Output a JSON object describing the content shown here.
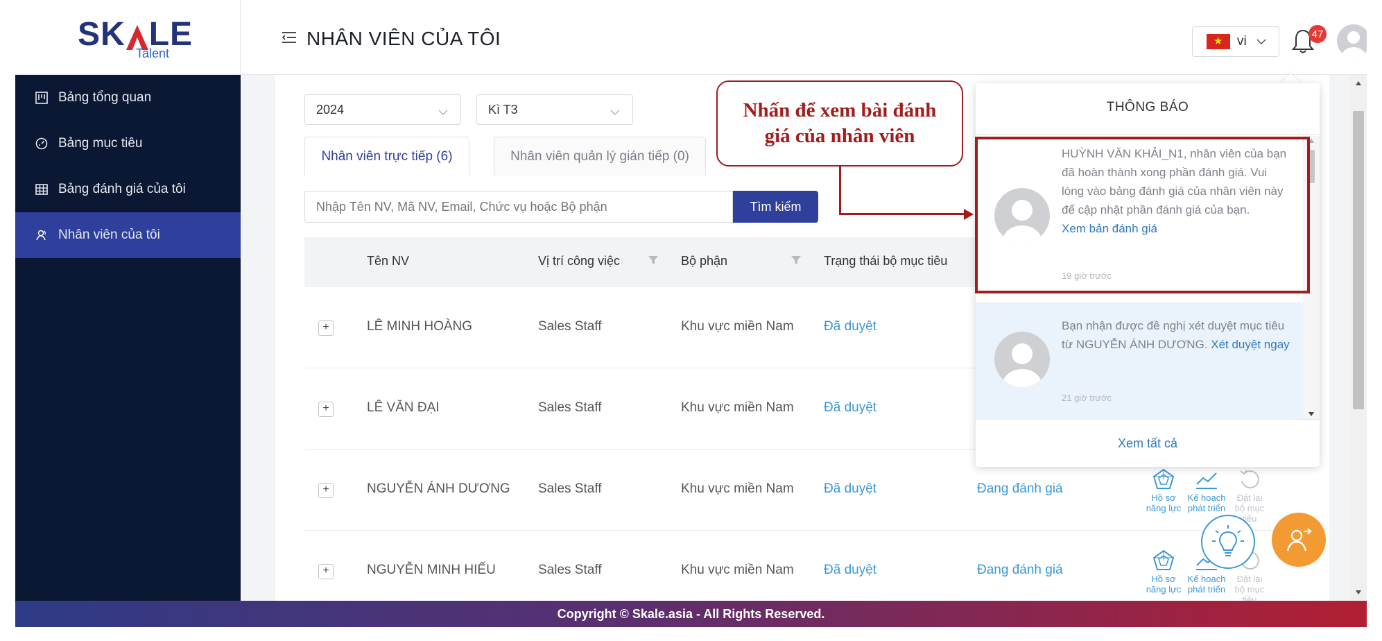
{
  "brand": {
    "logo_text_left": "SK",
    "logo_text_right": "LE",
    "logo_sub": "Talent"
  },
  "sidebar": {
    "items": [
      {
        "label": "Bảng tổng quan",
        "icon": "dashboard-icon"
      },
      {
        "label": "Bảng mục tiêu",
        "icon": "gauge-icon"
      },
      {
        "label": "Bảng đánh giá của tôi",
        "icon": "table-icon"
      },
      {
        "label": "Nhân viên của tôi",
        "icon": "people-icon",
        "active": true
      }
    ]
  },
  "header": {
    "title": "NHÂN VIÊN CỦA TÔI",
    "language": "vi",
    "notification_count": "47"
  },
  "filters": {
    "year": "2024",
    "period": "Kì T3"
  },
  "tabs": [
    {
      "label": "Nhân viên trực tiếp (6)",
      "active": true
    },
    {
      "label": "Nhân viên quản lý gián tiếp (0)",
      "active": false
    }
  ],
  "search": {
    "placeholder": "Nhập Tên NV, Mã NV, Email, Chức vụ hoặc Bộ phận",
    "button": "Tìm kiếm"
  },
  "table": {
    "columns": [
      "Tên NV",
      "Vị trí công việc",
      "Bộ phận",
      "Trạng thái bộ mục tiêu"
    ],
    "rows": [
      {
        "name": "LÊ MINH HOÀNG",
        "position": "Sales Staff",
        "department": "Khu vực miền Nam",
        "goal_status": "Đã duyệt",
        "review_status": ""
      },
      {
        "name": "LÊ VĂN ĐẠI",
        "position": "Sales Staff",
        "department": "Khu vực miền Nam",
        "goal_status": "Đã duyệt",
        "review_status": ""
      },
      {
        "name": "NGUYỄN ÁNH DƯƠNG",
        "position": "Sales Staff",
        "department": "Khu vực miền Nam",
        "goal_status": "Đã duyệt",
        "review_status": "Đang đánh giá"
      },
      {
        "name": "NGUYỄN MINH HIẾU",
        "position": "Sales Staff",
        "department": "Khu vực miền Nam",
        "goal_status": "Đã duyệt",
        "review_status": "Đang đánh giá"
      }
    ],
    "actions": {
      "profile_l1": "Hồ sơ",
      "profile_l2": "năng lực",
      "plan_l1": "Kế hoạch",
      "plan_l2": "phát triển",
      "reset_l1": "Đặt lại",
      "reset_l2": "bộ mục tiêu"
    }
  },
  "callout": {
    "text": "Nhấn để xem bài đánh giá của nhân viên"
  },
  "notifications": {
    "title": "THÔNG BÁO",
    "items": [
      {
        "text": "HUỲNH VĂN KHẢI_N1, nhân viên của bạn đã hoàn thành xong phần đánh giá. Vui lòng vào bảng đánh giá của nhân viên này để cập nhật phần đánh giá của bạn.",
        "link": "Xem bản đánh giá",
        "time": "19 giờ trước"
      },
      {
        "text": "Bạn nhận được đề nghị xét duyệt mục tiêu từ NGUYỄN ÁNH DƯƠNG.",
        "link": "Xét duyệt ngay",
        "time": "21 giờ trước"
      }
    ],
    "see_all": "Xem tất cả"
  },
  "footer": {
    "text": "Copyright © Skale.asia - All Rights Reserved."
  },
  "colors": {
    "sidebar_bg": "#0b1833",
    "active_nav": "#2e3f9c",
    "link": "#3b97d9",
    "callout": "#a31b1b",
    "fab": "#f39a32"
  }
}
